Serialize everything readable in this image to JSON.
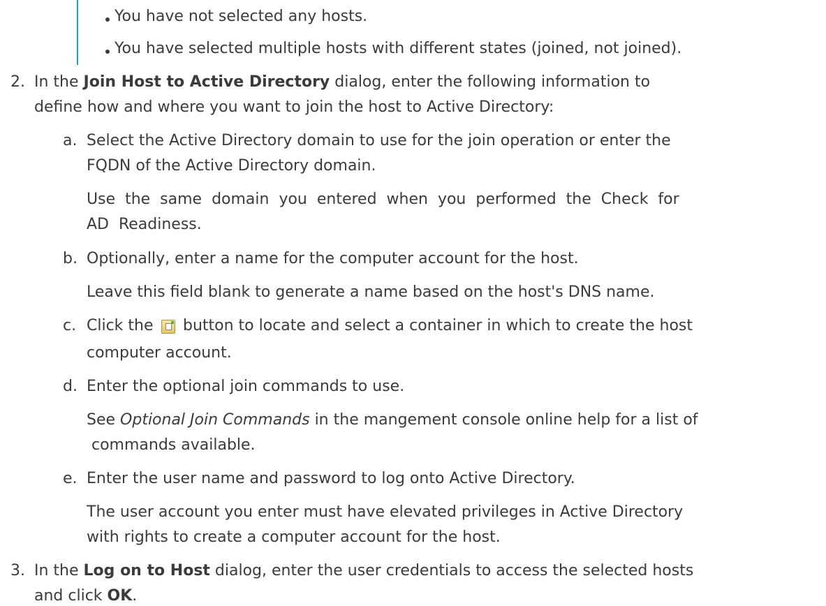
{
  "bullets": [
    "You have not selected any hosts.",
    "You have selected multiple hosts with different states (joined, not joined)."
  ],
  "step2": {
    "number": "2.",
    "pre": "In the ",
    "bold": "Join Host to Active Directory",
    "post": " dialog, enter the following information to",
    "line2": "define how and where you want to join the host to Active Directory:"
  },
  "substeps": {
    "a": {
      "letter": "a.",
      "line1": "Select the Active Directory domain to use for the join operation or enter the",
      "line2": "FQDN of the Active Directory domain.",
      "note1": "Use  the  same  domain  you  entered  when  you  performed  the  Check  for",
      "note2": "AD  Readiness."
    },
    "b": {
      "letter": "b.",
      "line1": "Optionally, enter a name for the computer account for the host.",
      "note1": "Leave this field blank to generate a name based on the host's DNS name."
    },
    "c": {
      "letter": "c.",
      "pre": "Click the ",
      "post": " button to locate and select a container in which to create the host",
      "line2": "computer account.",
      "icon": "browse-container-icon"
    },
    "d": {
      "letter": "d.",
      "line1": "Enter the optional join commands to use.",
      "note_pre": "See ",
      "note_italic": "Optional Join Commands",
      "note_post": " in the mangement console online help for a list of",
      "note2": " commands available."
    },
    "e": {
      "letter": "e.",
      "line1": "Enter the user name and password to log onto Active Directory.",
      "note1": "The user account you enter must have elevated privileges in Active Directory",
      "note2": "with rights to create a computer account for the host."
    }
  },
  "step3": {
    "number": "3.",
    "pre": "In the ",
    "bold": "Log on to Host",
    "post": " dialog, enter the user credentials to access the selected hosts",
    "line2_pre": "and click ",
    "line2_bold": "OK",
    "line2_post": "."
  }
}
